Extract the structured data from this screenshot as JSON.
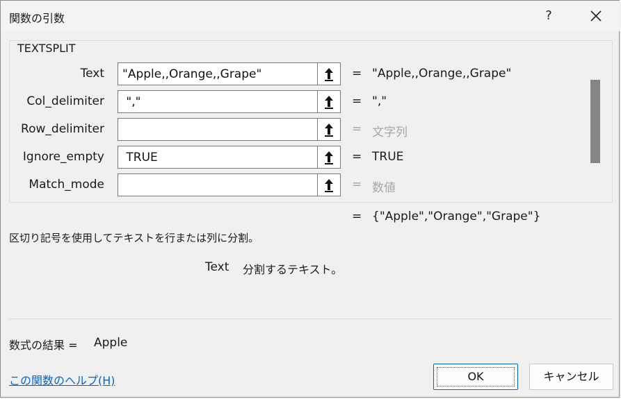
{
  "window": {
    "title": "関数の引数",
    "help_glyph": "?"
  },
  "function": {
    "name": "TEXTSPLIT",
    "args": [
      {
        "label": "Text",
        "value": "\"Apple,,Orange,,Grape\"",
        "result": "\"Apple,,Orange,,Grape\""
      },
      {
        "label": "Col_delimiter",
        "value": " \",\"",
        "result": "\",\""
      },
      {
        "label": "Row_delimiter",
        "value": "",
        "result": "文字列"
      },
      {
        "label": "Ignore_empty",
        "value": " TRUE",
        "result": "TRUE"
      },
      {
        "label": "Match_mode",
        "value": "",
        "result": "数値"
      }
    ],
    "equals": "=",
    "overall_result": "{\"Apple\",\"Orange\",\"Grape\"}",
    "description": "区切り記号を使用してテキストを行または列に分割。",
    "current_arg_name": "Text",
    "current_arg_desc": "分割するテキスト。"
  },
  "footer": {
    "formula_result_label": "数式の結果 =",
    "formula_result_value": "Apple",
    "help_link": "この関数のヘルプ(H)",
    "ok_label": "OK",
    "cancel_label": "キャンセル"
  },
  "colors": {
    "link": "#0066cc",
    "dim_text": "#a6a6a6",
    "ok_border": "#0067c0"
  },
  "icons": {
    "close": "close-icon",
    "collapse": "arrow-up-icon"
  }
}
